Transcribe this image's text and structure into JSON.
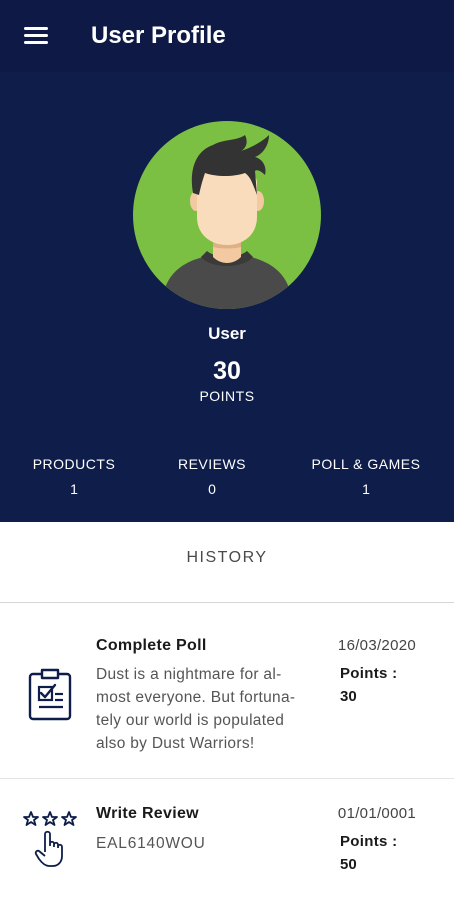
{
  "appbar": {
    "title": "User Profile",
    "menu_icon": "hamburger-menu-icon",
    "background": "#0e1a45"
  },
  "profile": {
    "avatar_icon": "user-avatar-icon",
    "avatar_background": "#7bc043",
    "name": "User",
    "points_value": "30",
    "points_label": "POINTS",
    "background": "#0e1d4a"
  },
  "stats": [
    {
      "label": "PRODUCTS",
      "value": "1"
    },
    {
      "label": "REVIEWS",
      "value": "0"
    },
    {
      "label": "POLL & GAMES",
      "value": "1"
    }
  ],
  "history": {
    "title": "HISTORY",
    "items": [
      {
        "icon": "clipboard-checklist-icon",
        "title": "Complete Poll",
        "description": "Dust is a nightmare for al-\nmost everyone. But fortuna-\ntely our world is populated\nalso by  Dust Warriors!",
        "date": "16/03/2020",
        "points_label": "Points :",
        "points_value": "30"
      },
      {
        "icon": "star-rating-tap-icon",
        "title": "Write Review",
        "description": "EAL6140WOU",
        "date": "01/01/0001",
        "points_label": "Points :",
        "points_value": "50"
      }
    ]
  }
}
